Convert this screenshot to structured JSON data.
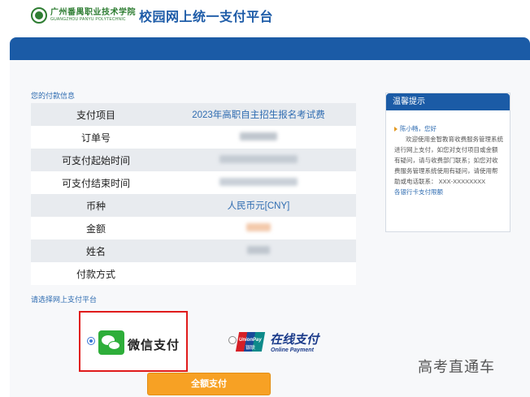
{
  "header": {
    "school_cn": "广州番禺职业技术学院",
    "school_en": "GUANGZHOU PANYU POLYTECHNIC",
    "site_title": "校园网上统一支付平台"
  },
  "payment_info": {
    "section_title": "您的付款信息",
    "rows": [
      {
        "label": "支付项目",
        "value": "2023年高职自主招生报名考试费"
      },
      {
        "label": "订单号",
        "value": ""
      },
      {
        "label": "可支付起始时间",
        "value": ""
      },
      {
        "label": "可支付结束时间",
        "value": ""
      },
      {
        "label": "币种",
        "value": "人民币元[CNY]"
      },
      {
        "label": "金额",
        "value": ""
      },
      {
        "label": "姓名",
        "value": ""
      },
      {
        "label": "付款方式",
        "value": ""
      }
    ]
  },
  "tips": {
    "title": "温馨提示",
    "greeting": "陈小畅，您好",
    "body": "欢迎使用金智教育收费服务管理系统进行网上支付，如您对支付项目或金额有疑问，请与收费部门联系；如您对收费服务管理系统使用有疑问，请使用帮助或电话联系： XXX-XXXXXXXX",
    "link": "各银行卡支付限额"
  },
  "platform": {
    "section_title": "请选择网上支付平台",
    "wechat_label": "微信支付",
    "unionpay_brand": "UnionPay",
    "unionpay_cn": "银联",
    "online_label": "在线支付",
    "online_sub": "Online Payment",
    "selected": "wechat"
  },
  "actions": {
    "pay_label": "全额支付"
  },
  "watermark": "高考直通车",
  "colors": {
    "brand_blue": "#1b5ba6",
    "link_blue": "#2f6cb1",
    "button_orange": "#f7a124",
    "highlight_red": "#e01b1b",
    "wechat_green": "#2eae3a"
  }
}
